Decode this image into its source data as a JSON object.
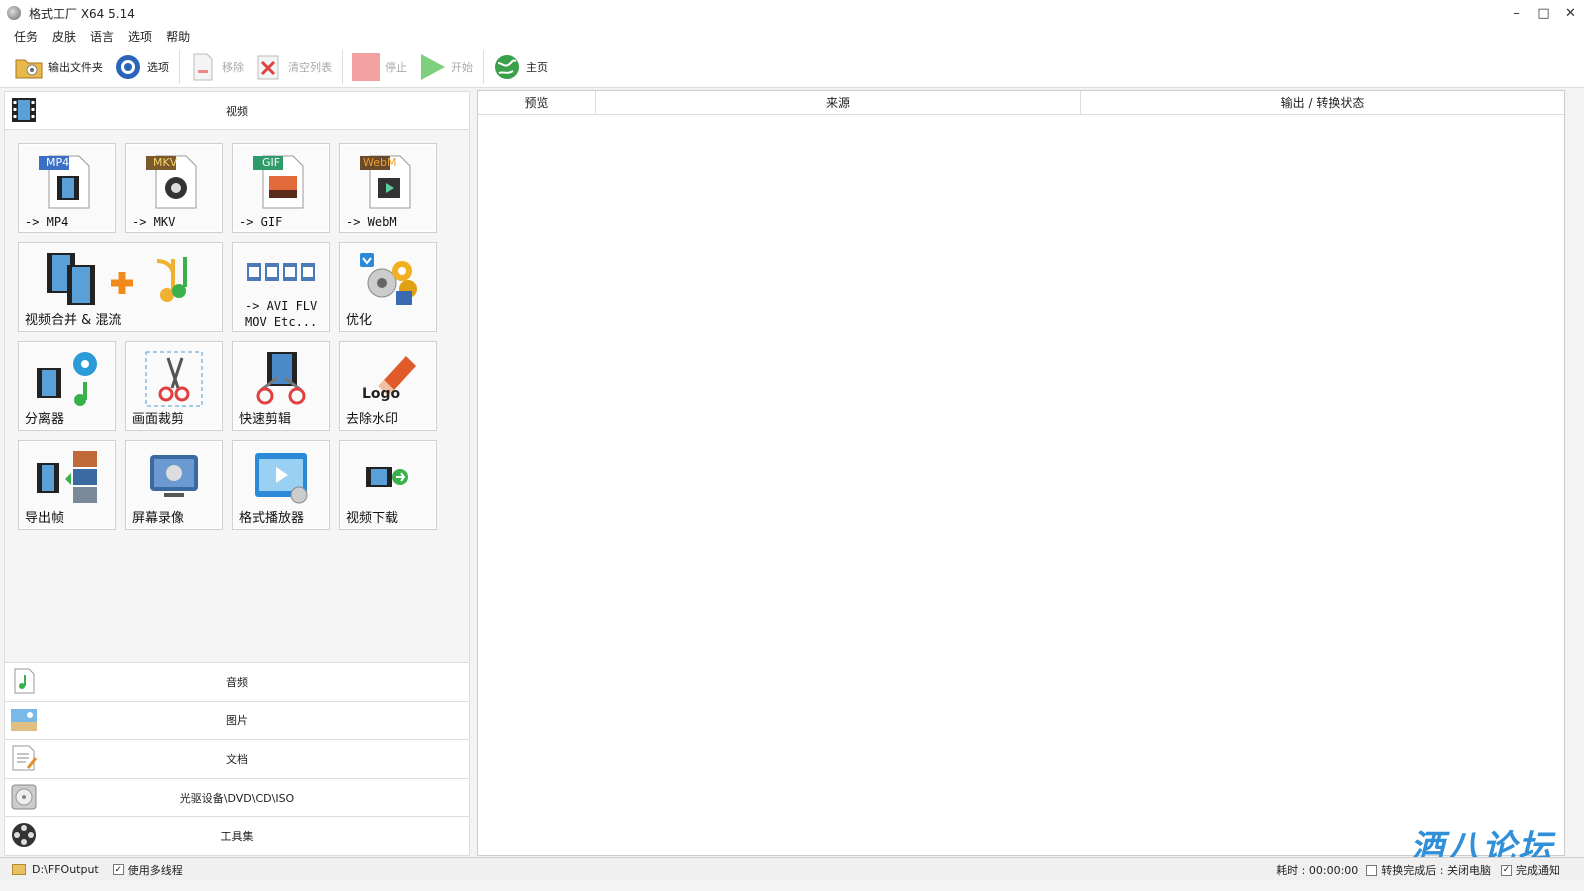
{
  "window": {
    "title": "格式工厂 X64 5.14",
    "controls": [
      "–",
      "□",
      "✕"
    ]
  },
  "menu": [
    "任务",
    "皮肤",
    "语言",
    "选项",
    "帮助"
  ],
  "toolbar": {
    "output_folder": "输出文件夹",
    "options": "选项",
    "remove": "移除",
    "clear_list": "清空列表",
    "stop": "停止",
    "start": "开始",
    "home": "主页"
  },
  "left": {
    "video_category": "视频",
    "tiles": [
      {
        "label": "-> MP4",
        "badge": "MP4",
        "badge_color": "#3a6fc4"
      },
      {
        "label": "-> MKV",
        "badge": "MKV",
        "badge_color": "#7a5a2a"
      },
      {
        "label": "-> GIF",
        "badge": "GIF",
        "badge_color": "#2f9a6a"
      },
      {
        "label": "-> WebM",
        "badge": "WebM",
        "badge_color": "#c47a2a"
      },
      {
        "label": "视频合并 & 混流"
      },
      {
        "label_line1": "-> AVI FLV",
        "label_line2": "MOV Etc..."
      },
      {
        "label": "优化"
      },
      {
        "label": "分离器"
      },
      {
        "label": "画面裁剪"
      },
      {
        "label": "快速剪辑"
      },
      {
        "label": "去除水印",
        "logo_text": "Logo"
      },
      {
        "label": "导出帧"
      },
      {
        "label": "屏幕录像"
      },
      {
        "label": "格式播放器"
      },
      {
        "label": "视频下载"
      }
    ],
    "bottom_categories": [
      "音频",
      "图片",
      "文档",
      "光驱设备\\DVD\\CD\\ISO",
      "工具集"
    ]
  },
  "table": {
    "columns": [
      "预览",
      "来源",
      "输出 / 转换状态"
    ]
  },
  "status": {
    "output_path": "D:\\FFOutput",
    "multithread": "使用多线程",
    "elapsed": "耗时 : 00:00:00",
    "after_done": "转换完成后 : 关闭电脑",
    "notify": "完成通知"
  },
  "watermark": "酒八论坛"
}
